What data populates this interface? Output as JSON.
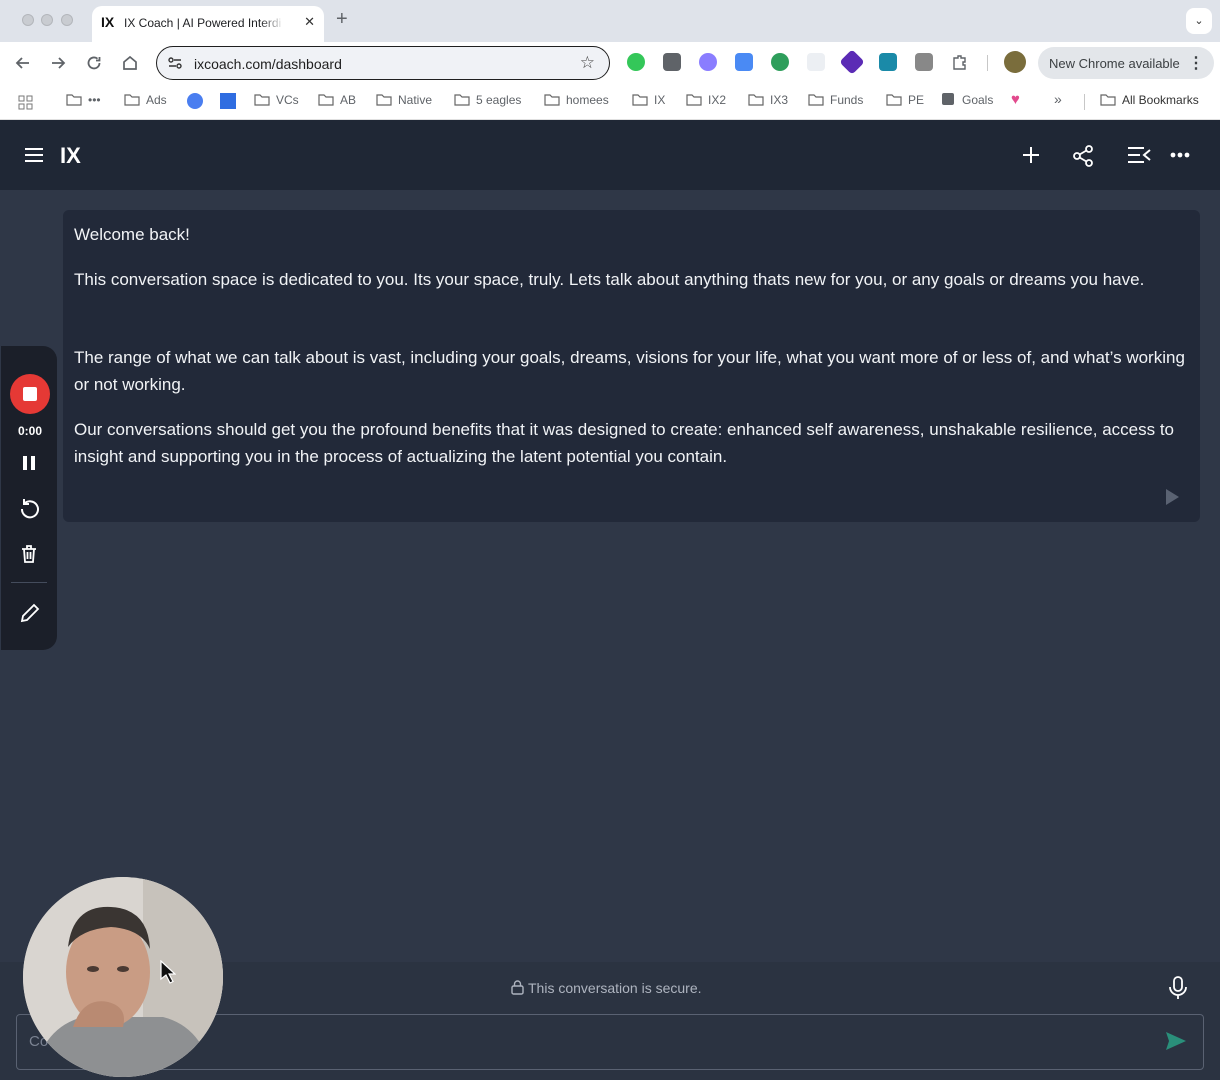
{
  "browser": {
    "tab": {
      "logo": "IX",
      "title": "IX Coach | AI Powered Interdi"
    },
    "url": "ixcoach.com/dashboard",
    "update_chip": "New Chrome available",
    "bookmarks": [
      "Ads",
      "VCs",
      "AB",
      "Native",
      "5 eagles",
      "homees",
      "IX",
      "IX2",
      "IX3",
      "Funds",
      "PE",
      "Goals"
    ],
    "all_bookmarks": "All Bookmarks"
  },
  "app": {
    "logo": "IX",
    "message": {
      "greeting": "Welcome back!",
      "p1": "This conversation space is dedicated to you. Its your space, truly. Lets talk about anything thats new for you, or any goals or dreams you have.",
      "p2": "The range of what we can talk about is vast, including your goals, dreams, visions for your life, what you want more of or less of, and what’s working or not working.",
      "p3": "Our conversations should get you the profound benefits that it was designed to create: enhanced self awareness, unshakable resilience, access to insight and supporting you in the process of actualizing the latent potential you contain."
    },
    "recorder": {
      "time": "0:00"
    },
    "secure_text": "This conversation is secure.",
    "input_placeholder": "Co…ion... or type \"/\""
  },
  "colors": {
    "record": "#e53935",
    "send": "#2a8f7a",
    "app_bg": "#2f3747",
    "header_bg": "#1f2735"
  }
}
